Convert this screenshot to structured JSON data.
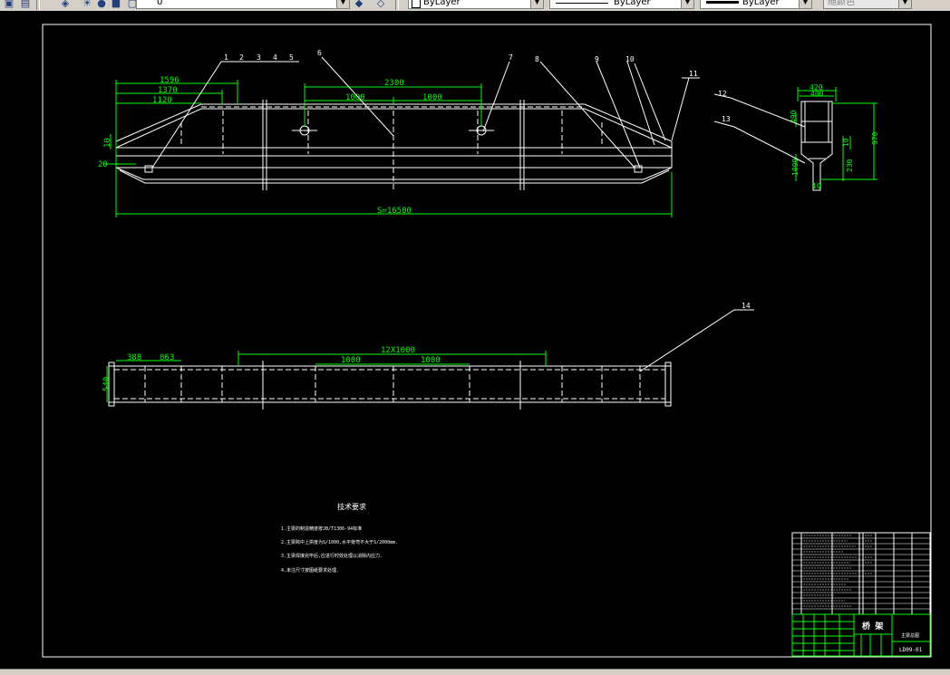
{
  "toolbar": {
    "layer_combo_value": "0",
    "color_combo_value": "ByLayer",
    "linetype_combo_value": "ByLayer",
    "lineweight_combo_value": "ByLayer",
    "plotstyle_combo_value": "随颜色",
    "dropdown_glyph": "▼"
  },
  "drawing": {
    "colors": {
      "background": "#000000",
      "outline": "#ffffff",
      "dimension": "#00ff00",
      "leader": "#ffffff",
      "title_block": "#ffffff"
    },
    "top_view_dimensions": {
      "d1596": "1596",
      "d1370": "1370",
      "d1120": "1120",
      "d2300": "2300",
      "d1000a": "1000",
      "d1000b": "1000",
      "span": "S=16500",
      "left_10": "10",
      "left_20": "20"
    },
    "section_view_dimensions": {
      "d420": "420",
      "d400": "400",
      "d970": "970",
      "d490": "490",
      "d1090": "1090",
      "d230": "230",
      "d10a": "10",
      "d10b": "10"
    },
    "bottom_view_dimensions": {
      "d388": "388",
      "d863": "863",
      "d12x1000": "12X1000",
      "d1000a": "1000",
      "d1000b": "1000",
      "d540": "540"
    },
    "part_numbers": [
      "1",
      "2",
      "3",
      "4",
      "5",
      "6",
      "7",
      "8",
      "9",
      "10",
      "11",
      "12",
      "13",
      "14"
    ],
    "notes": {
      "title": "技术要求",
      "line1": "1.主梁的制造精度按JB/T1306-94标准",
      "line2": "2.主梁跨中上拱度为S/1000,水平旁弯不大于S/2000mm.",
      "line3": "3.主梁焊接完毕后,应进行时效处理以消除内应力.",
      "line4": "4.未注尺寸按图纸要求处理."
    },
    "title_block": {
      "name": "桥 架",
      "subtitle": "主梁总图",
      "drawing_no": "LD09-01"
    }
  }
}
